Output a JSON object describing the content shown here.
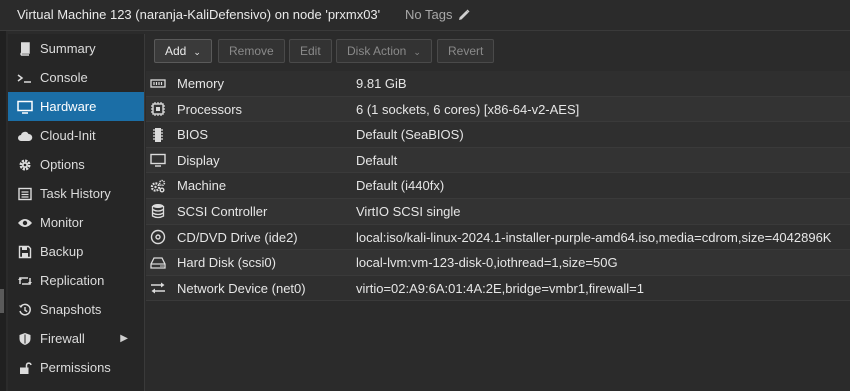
{
  "title": {
    "vm_label": "Virtual Machine 123 (naranja-KaliDefensivo) on node 'prxmx03'",
    "tags": "No Tags"
  },
  "sidebar": {
    "items": [
      {
        "label": "Summary",
        "icon": "book-icon"
      },
      {
        "label": "Console",
        "icon": "terminal-icon"
      },
      {
        "label": "Hardware",
        "icon": "monitor-icon",
        "active": true
      },
      {
        "label": "Cloud-Init",
        "icon": "cloud-icon"
      },
      {
        "label": "Options",
        "icon": "gear-icon"
      },
      {
        "label": "Task History",
        "icon": "list-icon"
      },
      {
        "label": "Monitor",
        "icon": "eye-icon"
      },
      {
        "label": "Backup",
        "icon": "floppy-icon"
      },
      {
        "label": "Replication",
        "icon": "retweet-icon"
      },
      {
        "label": "Snapshots",
        "icon": "history-icon"
      },
      {
        "label": "Firewall",
        "icon": "shield-icon",
        "has_submenu": true
      },
      {
        "label": "Permissions",
        "icon": "unlock-icon"
      }
    ]
  },
  "toolbar": {
    "add_label": "Add",
    "remove_label": "Remove",
    "edit_label": "Edit",
    "disk_action_label": "Disk Action",
    "revert_label": "Revert"
  },
  "hardware": {
    "rows": [
      {
        "name": "Memory",
        "value": "9.81 GiB",
        "icon": "memory-icon"
      },
      {
        "name": "Processors",
        "value": "6 (1 sockets, 6 cores) [x86-64-v2-AES]",
        "icon": "cpu-icon"
      },
      {
        "name": "BIOS",
        "value": "Default (SeaBIOS)",
        "icon": "microchip-icon"
      },
      {
        "name": "Display",
        "value": "Default",
        "icon": "desktop-icon"
      },
      {
        "name": "Machine",
        "value": "Default (i440fx)",
        "icon": "cogs-icon"
      },
      {
        "name": "SCSI Controller",
        "value": "VirtIO SCSI single",
        "icon": "database-icon"
      },
      {
        "name": "CD/DVD Drive (ide2)",
        "value": "local:iso/kali-linux-2024.1-installer-purple-amd64.iso,media=cdrom,size=4042896K",
        "icon": "cdrom-icon"
      },
      {
        "name": "Hard Disk (scsi0)",
        "value": "local-lvm:vm-123-disk-0,iothread=1,size=50G",
        "icon": "hdd-icon"
      },
      {
        "name": "Network Device (net0)",
        "value": "virtio=02:A9:6A:01:4A:2E,bridge=vmbr1,firewall=1",
        "icon": "exchange-icon"
      }
    ]
  },
  "colors": {
    "background": "#2b2b2b",
    "active_item": "#1b6ea6",
    "text": "#e6e6e6"
  }
}
